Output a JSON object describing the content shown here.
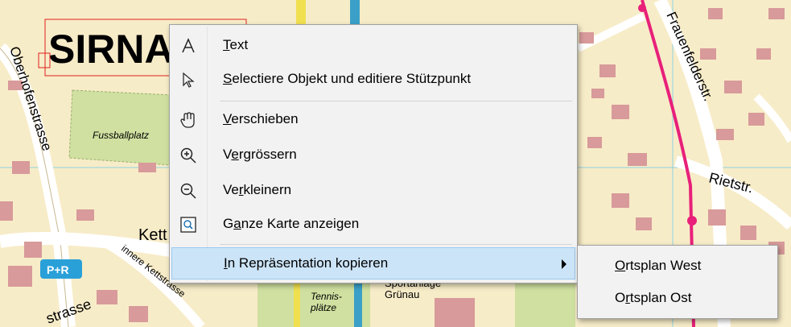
{
  "map": {
    "place_name": "SIRNA",
    "streets": {
      "oberhofenstrasse": "Oberhofenstrasse",
      "frauenfelderstr": "Frauenfelderstr.",
      "rietstr": "Rietstr.",
      "kett": "Kett",
      "innere_kettstrasse": "innere Kettstrasse",
      "strasse_bottom": "strasse"
    },
    "places": {
      "fussballplatz": "Fussballplatz",
      "tennisplatze_1": "Tennis-",
      "tennisplatze_2": "plätze",
      "sportanlage": "Sportanlage",
      "grunau": "Grünau"
    },
    "park_ride": "P+R",
    "colors": {
      "background": "#f7ecc8",
      "building": "#d89a9a",
      "green": "#cfe0a0",
      "rail": "#e8207a",
      "water": "#3aa0c8",
      "road": "#ffffff"
    }
  },
  "context_menu": {
    "items": [
      {
        "id": "text",
        "icon": "text-cursor-icon",
        "pre": "",
        "key": "T",
        "post": "ext"
      },
      {
        "id": "select",
        "icon": "pointer-arrow-icon",
        "pre": "",
        "key": "S",
        "post": "electiere Objekt und editiere Stützpunkt"
      },
      {
        "id": "pan",
        "icon": "hand-icon",
        "pre": "",
        "key": "V",
        "post": "erschieben"
      },
      {
        "id": "zoom_in",
        "icon": "zoom-in-icon",
        "pre": "V",
        "key": "e",
        "post": "rgrössern"
      },
      {
        "id": "zoom_out",
        "icon": "zoom-out-icon",
        "pre": "Ve",
        "key": "r",
        "post": "kleinern"
      },
      {
        "id": "full_map",
        "icon": "full-extent-icon",
        "pre": "G",
        "key": "a",
        "post": "nze Karte anzeigen"
      },
      {
        "id": "copy_repr",
        "icon": "",
        "pre": "",
        "key": "I",
        "post": "n Repräsentation kopieren"
      }
    ]
  },
  "submenu": {
    "items": [
      {
        "id": "west",
        "pre": "",
        "key": "O",
        "post": "rtsplan West"
      },
      {
        "id": "ost",
        "pre": "O",
        "key": "r",
        "post": "tsplan Ost"
      }
    ]
  }
}
